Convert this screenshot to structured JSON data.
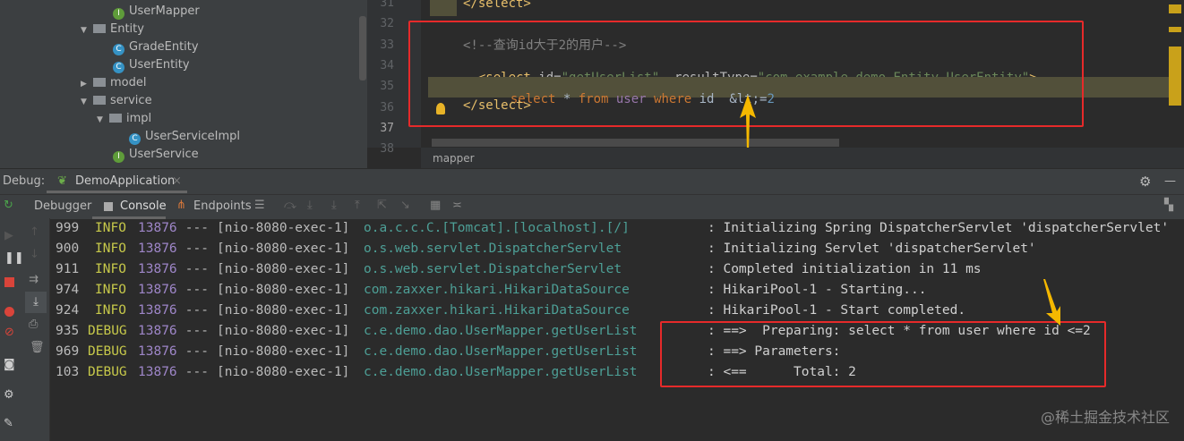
{
  "tree": [
    {
      "label": "UserMapper",
      "kind": "interface",
      "indent": 2
    },
    {
      "label": "Entity",
      "kind": "folder",
      "indent": 1,
      "expanded": true
    },
    {
      "label": "GradeEntity",
      "kind": "class",
      "indent": 2
    },
    {
      "label": "UserEntity",
      "kind": "class",
      "indent": 2
    },
    {
      "label": "model",
      "kind": "folder",
      "indent": 1,
      "expanded": false
    },
    {
      "label": "service",
      "kind": "folder",
      "indent": 1,
      "expanded": true
    },
    {
      "label": "impl",
      "kind": "folder",
      "indent": 2,
      "expanded": true
    },
    {
      "label": "UserServiceImpl",
      "kind": "class",
      "indent": 3
    },
    {
      "label": "UserService",
      "kind": "interface",
      "indent": 2
    }
  ],
  "editor": {
    "line_numbers": [
      "31",
      "32",
      "33",
      "34",
      "35",
      "36",
      "37",
      "38"
    ],
    "line31": "</select>",
    "comment": "<!--查询id大于2的用户-->",
    "sel_open": "<select ",
    "attr_id": "id=",
    "val_id": "\"getUserList\"",
    "attr_rt": "  resultType=",
    "val_rt": "\"com.example.demo.Entity.UserEntity\"",
    "gt": ">",
    "sql_kw1": "select",
    "sql_star": " * ",
    "sql_kw2": "from",
    "sql_user": " user ",
    "sql_kw3": "where",
    "sql_id": " id  &lt;=",
    "sql_num": "2",
    "line36": "</select>",
    "breadcrumb": "mapper"
  },
  "debug": {
    "label": "Debug:",
    "run_tab": "DemoApplication",
    "tabs": [
      "Debugger",
      "Console",
      "Endpoints"
    ]
  },
  "console": {
    "rows": [
      {
        "ts": "999",
        "level": "INFO",
        "pid": "13876",
        "sep": " --- ",
        "thread": "[nio-8080-exec-1]",
        "logger": "o.a.c.c.C.[Tomcat].[localhost].[/]",
        "msg": ": Initializing Spring DispatcherServlet 'dispatcherServlet'"
      },
      {
        "ts": "900",
        "level": "INFO",
        "pid": "13876",
        "sep": " --- ",
        "thread": "[nio-8080-exec-1]",
        "logger": "o.s.web.servlet.DispatcherServlet",
        "msg": ": Initializing Servlet 'dispatcherServlet'"
      },
      {
        "ts": "911",
        "level": "INFO",
        "pid": "13876",
        "sep": " --- ",
        "thread": "[nio-8080-exec-1]",
        "logger": "o.s.web.servlet.DispatcherServlet",
        "msg": ": Completed initialization in 11 ms"
      },
      {
        "ts": "974",
        "level": "INFO",
        "pid": "13876",
        "sep": " --- ",
        "thread": "[nio-8080-exec-1]",
        "logger": "com.zaxxer.hikari.HikariDataSource",
        "msg": ": HikariPool-1 - Starting..."
      },
      {
        "ts": "924",
        "level": "INFO",
        "pid": "13876",
        "sep": " --- ",
        "thread": "[nio-8080-exec-1]",
        "logger": "com.zaxxer.hikari.HikariDataSource",
        "msg": ": HikariPool-1 - Start completed."
      },
      {
        "ts": "935",
        "level": "DEBUG",
        "pid": "13876",
        "sep": " --- ",
        "thread": "[nio-8080-exec-1]",
        "logger": "c.e.demo.dao.UserMapper.getUserList",
        "msg": ": ==>  Preparing: select * from user where id <=2"
      },
      {
        "ts": "969",
        "level": "DEBUG",
        "pid": "13876",
        "sep": " --- ",
        "thread": "[nio-8080-exec-1]",
        "logger": "c.e.demo.dao.UserMapper.getUserList",
        "msg": ": ==> Parameters: "
      },
      {
        "ts": "103",
        "level": "DEBUG",
        "pid": "13876",
        "sep": " --- ",
        "thread": "[nio-8080-exec-1]",
        "logger": "c.e.demo.dao.UserMapper.getUserList",
        "msg": ": <==      Total: 2"
      }
    ]
  },
  "watermark": "@稀土掘金技术社区",
  "colors": {
    "info": "#c7c94a",
    "pid": "#9e86c8",
    "logger": "#4d9f96",
    "highlight": "#e62a2a",
    "arrow": "#f5b800"
  }
}
